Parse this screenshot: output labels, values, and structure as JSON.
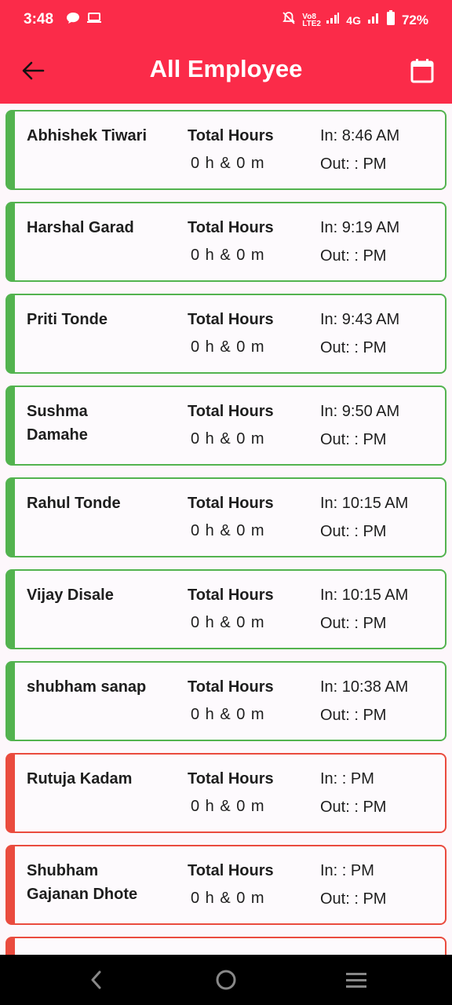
{
  "status_bar": {
    "time": "3:48",
    "network": "4G",
    "volte": "Vo8 LTE2",
    "battery": "72%"
  },
  "app_bar": {
    "title": "All Employee",
    "back_icon": "arrow-left-icon",
    "calendar_icon": "calendar-icon"
  },
  "colors": {
    "primary": "#fb2b49",
    "present": "#53b34f",
    "absent": "#ea4b3e"
  },
  "employees": [
    {
      "name": "Abhishek Tiwari",
      "total_label": "Total Hours",
      "total_value": "0 h & 0 m",
      "in": "In: 8:46 AM",
      "out": "Out: : PM",
      "status": "present"
    },
    {
      "name": "Harshal Garad",
      "total_label": "Total Hours",
      "total_value": "0 h & 0 m",
      "in": "In: 9:19 AM",
      "out": "Out: : PM",
      "status": "present"
    },
    {
      "name": "Priti Tonde",
      "total_label": "Total Hours",
      "total_value": "0 h & 0 m",
      "in": "In: 9:43 AM",
      "out": "Out: : PM",
      "status": "present"
    },
    {
      "name": "Sushma Damahe",
      "total_label": "Total Hours",
      "total_value": "0 h & 0 m",
      "in": "In: 9:50 AM",
      "out": "Out: : PM",
      "status": "present"
    },
    {
      "name": "Rahul Tonde",
      "total_label": "Total Hours",
      "total_value": "0 h & 0 m",
      "in": "In: 10:15 AM",
      "out": "Out: : PM",
      "status": "present"
    },
    {
      "name": "Vijay Disale",
      "total_label": "Total Hours",
      "total_value": "0 h & 0 m",
      "in": "In: 10:15 AM",
      "out": "Out: : PM",
      "status": "present"
    },
    {
      "name": "shubham sanap",
      "total_label": "Total Hours",
      "total_value": "0 h & 0 m",
      "in": "In: 10:38 AM",
      "out": "Out: : PM",
      "status": "present"
    },
    {
      "name": "Rutuja Kadam",
      "total_label": "Total Hours",
      "total_value": "0 h & 0 m",
      "in": "In: : PM",
      "out": "Out: : PM",
      "status": "absent"
    },
    {
      "name": "Shubham Gajanan Dhote",
      "total_label": "Total Hours",
      "total_value": "0 h & 0 m",
      "in": "In: : PM",
      "out": "Out: : PM",
      "status": "absent"
    },
    {
      "name": "",
      "total_label": "",
      "total_value": "",
      "in": "",
      "out": "",
      "status": "absent"
    }
  ],
  "nav_bar": {
    "back_icon": "nav-back-icon",
    "home_icon": "nav-home-icon",
    "recents_icon": "nav-recents-icon"
  }
}
